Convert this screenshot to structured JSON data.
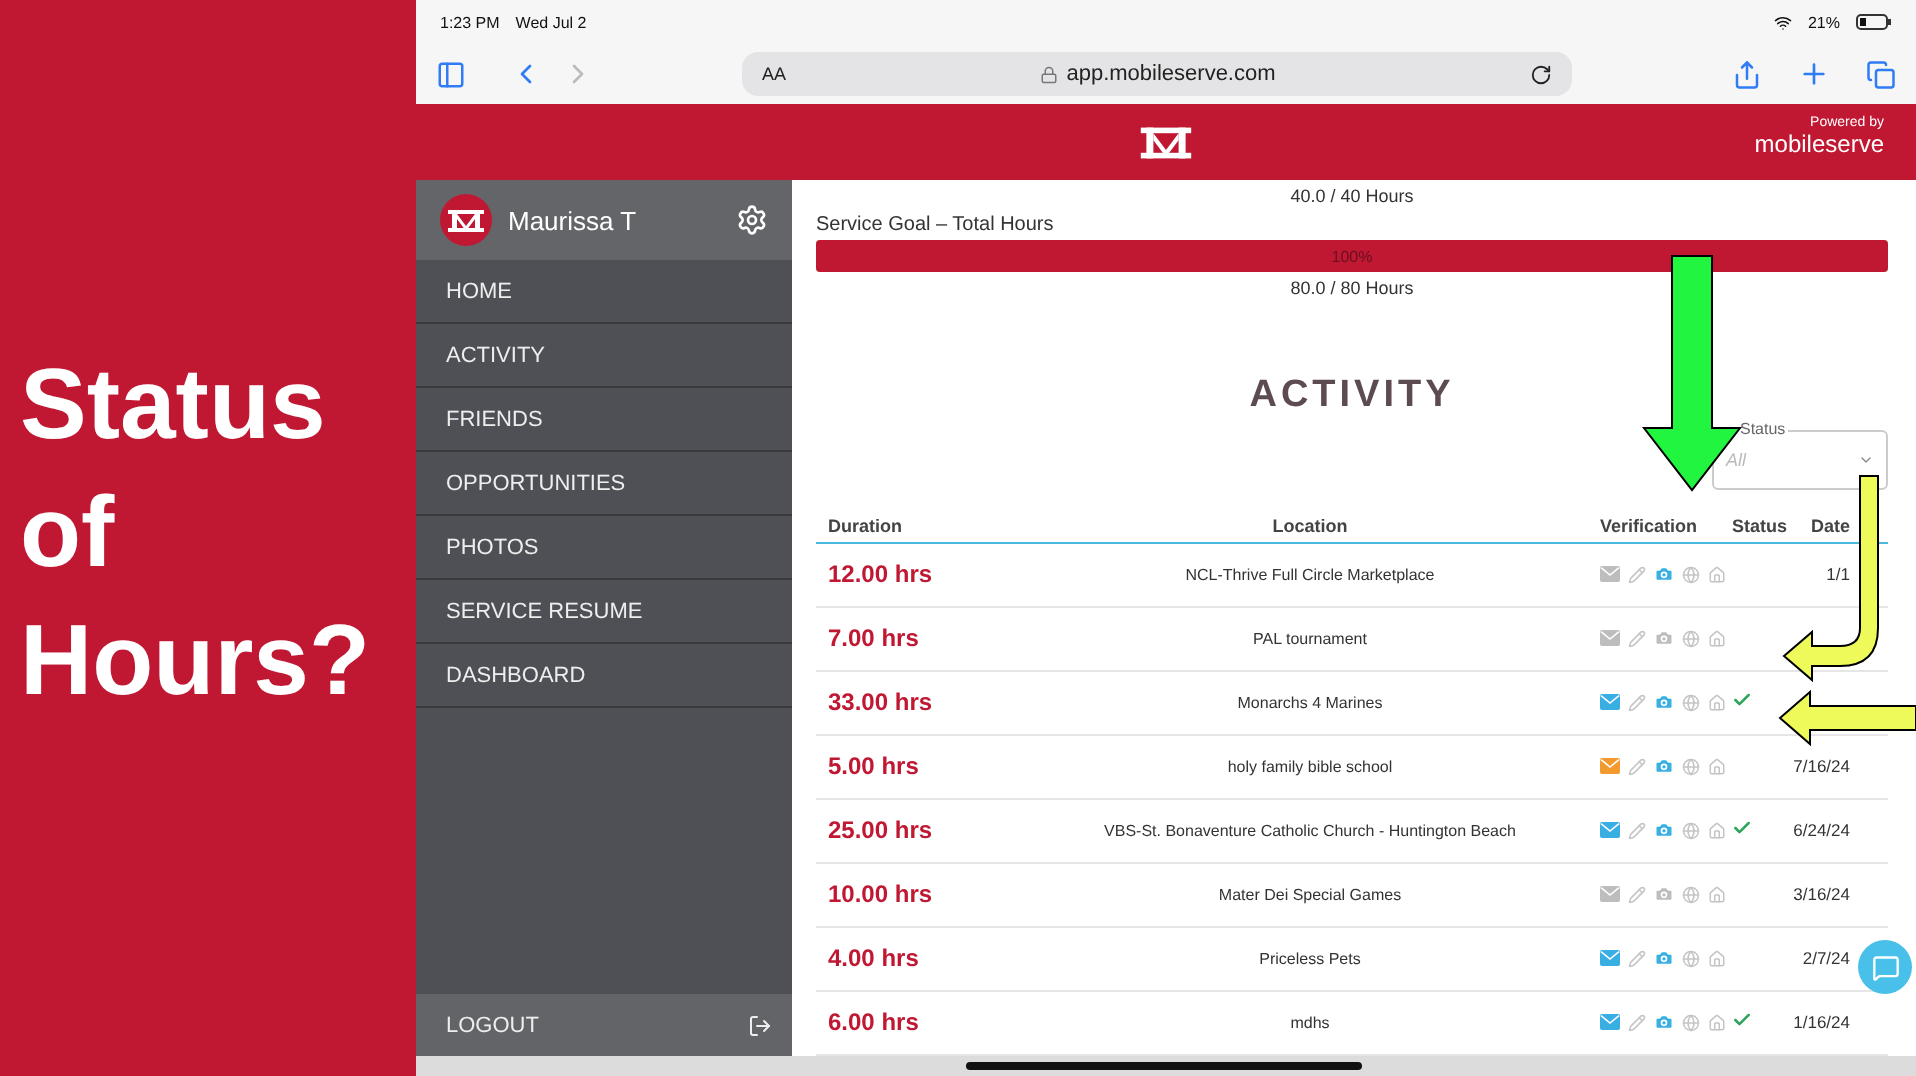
{
  "slide": {
    "heading": "Status of Hours?"
  },
  "status_bar": {
    "time": "1:23 PM",
    "date": "Wed Jul 2",
    "battery": "21%"
  },
  "browser": {
    "text_size": "AA",
    "url": "app.mobileserve.com"
  },
  "header": {
    "powered_by": "Powered by",
    "brand": "mobileserve"
  },
  "sidebar": {
    "user": "Maurissa T",
    "items": [
      "HOME",
      "ACTIVITY",
      "FRIENDS",
      "OPPORTUNITIES",
      "PHOTOS",
      "SERVICE RESUME",
      "DASHBOARD"
    ],
    "logout": "LOGOUT"
  },
  "goal": {
    "top": "40.0 / 40 Hours",
    "label": "Service Goal – Total Hours",
    "level": 1,
    "bar_text": "100%",
    "bottom": "80.0 / 80 Hours"
  },
  "title": "ACTIVITY",
  "filter": {
    "label": "Status",
    "placeholder": "All"
  },
  "columns": [
    "Duration",
    "Location",
    "Verification",
    "Status",
    "Date"
  ],
  "rows": [
    {
      "duration": "12.00 hrs",
      "location": "NCL-Thrive Full Circle Marketplace",
      "mail": {
        "color": "#bdbdbd"
      },
      "photo": true,
      "verified": false,
      "date": "1/1"
    },
    {
      "duration": "7.00 hrs",
      "location": "PAL tournament",
      "mail": {
        "color": "#bdbdbd"
      },
      "photo": false,
      "verified": false
    },
    {
      "duration": "33.00 hrs",
      "location": "Monarchs 4 Marines",
      "mail": {
        "color": "#39aee3"
      },
      "photo": true,
      "verified": true
    },
    {
      "duration": "5.00 hrs",
      "location": "holy family bible school",
      "mail": {
        "color": "#f39a2e"
      },
      "photo": true,
      "verified": false,
      "date": "7/16/24"
    },
    {
      "duration": "25.00 hrs",
      "location": "VBS-St. Bonaventure Catholic Church - Huntington Beach",
      "mail": {
        "color": "#39aee3"
      },
      "photo": true,
      "verified": true,
      "date": "6/24/24"
    },
    {
      "duration": "10.00 hrs",
      "location": "Mater Dei Special Games",
      "mail": {
        "color": "#bdbdbd"
      },
      "photo": false,
      "verified": false,
      "date": "3/16/24"
    },
    {
      "duration": "4.00 hrs",
      "location": "Priceless Pets",
      "mail": {
        "color": "#39aee3"
      },
      "photo": true,
      "verified": false,
      "date": "2/7/24"
    },
    {
      "duration": "6.00 hrs",
      "location": "mdhs",
      "mail": {
        "color": "#39aee3"
      },
      "photo": true,
      "verified": true,
      "date": "1/16/24"
    }
  ]
}
